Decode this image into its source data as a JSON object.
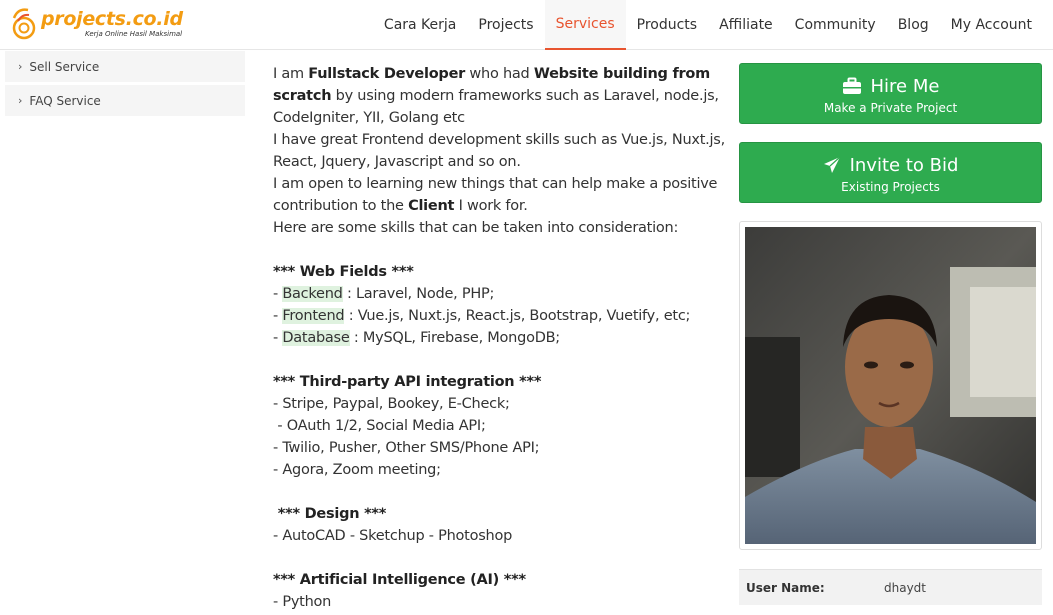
{
  "logo": {
    "name": "projects.co.id",
    "tagline": "Kerja Online Hasil Maksimal"
  },
  "nav": {
    "items": [
      {
        "label": "Cara Kerja"
      },
      {
        "label": "Projects"
      },
      {
        "label": "Services"
      },
      {
        "label": "Products"
      },
      {
        "label": "Affiliate"
      },
      {
        "label": "Community"
      },
      {
        "label": "Blog"
      },
      {
        "label": "My Account"
      }
    ],
    "active": "Services",
    "active_color": "#e8542f"
  },
  "sidebar": {
    "items": [
      {
        "label": "Sell Service"
      },
      {
        "label": "FAQ Service"
      }
    ]
  },
  "description": {
    "intro": {
      "i_am": "I am ",
      "role": "Fullstack Developer",
      "who_had": " who had ",
      "skill_a": "Website building from",
      "skill_b": "scratch",
      "rest1": " by using modern frameworks such as Laravel, node.js,",
      "line3": "CodeIgniter, YII, Golang etc",
      "line4": "I have great Frontend development skills such as Vue.js, Nuxt.js,",
      "line5": "React, Jquery, Javascript and so on.",
      "line6": "I am open to learning new things that can help make a positive",
      "line7a": "contribution to the ",
      "line7b": "Client",
      "line7c": " I work for.",
      "line8": "Here are some skills that can be taken into consideration:"
    },
    "web_fields": {
      "heading": "*** Web Fields ***",
      "items": [
        {
          "dash": "- ",
          "key": "Backend",
          "value": " : Laravel, Node, PHP;"
        },
        {
          "dash": "- ",
          "key": "Frontend",
          "value": " : Vue.js, Nuxt.js, React.js, Bootstrap, Vuetify, etc;"
        },
        {
          "dash": "- ",
          "key": "Database",
          "value": " : MySQL, Firebase, MongoDB;"
        }
      ]
    },
    "api": {
      "heading": "*** Third-party API integration ***",
      "items": [
        "- Stripe, Paypal, Bookey, E-Check;",
        " - OAuth 1/2, Social Media API;",
        "- Twilio, Pusher, Other SMS/Phone API;",
        "- Agora, Zoom meeting;"
      ]
    },
    "design": {
      "heading": " *** Design ***",
      "items": [
        "- AutoCAD - Sketchup - Photoshop"
      ]
    },
    "ai": {
      "heading": "*** Artificial Intelligence (AI) ***",
      "items": [
        "- Python"
      ]
    }
  },
  "actions": {
    "hire": {
      "title": "Hire Me",
      "subtitle": "Make a Private Project",
      "icon": "briefcase-icon"
    },
    "invite": {
      "title": "Invite to Bid",
      "subtitle": "Existing Projects",
      "icon": "paper-plane-icon"
    },
    "button_color": "#2eab4f"
  },
  "profile": {
    "username_label": "User Name:",
    "username_value": "dhaydt"
  }
}
